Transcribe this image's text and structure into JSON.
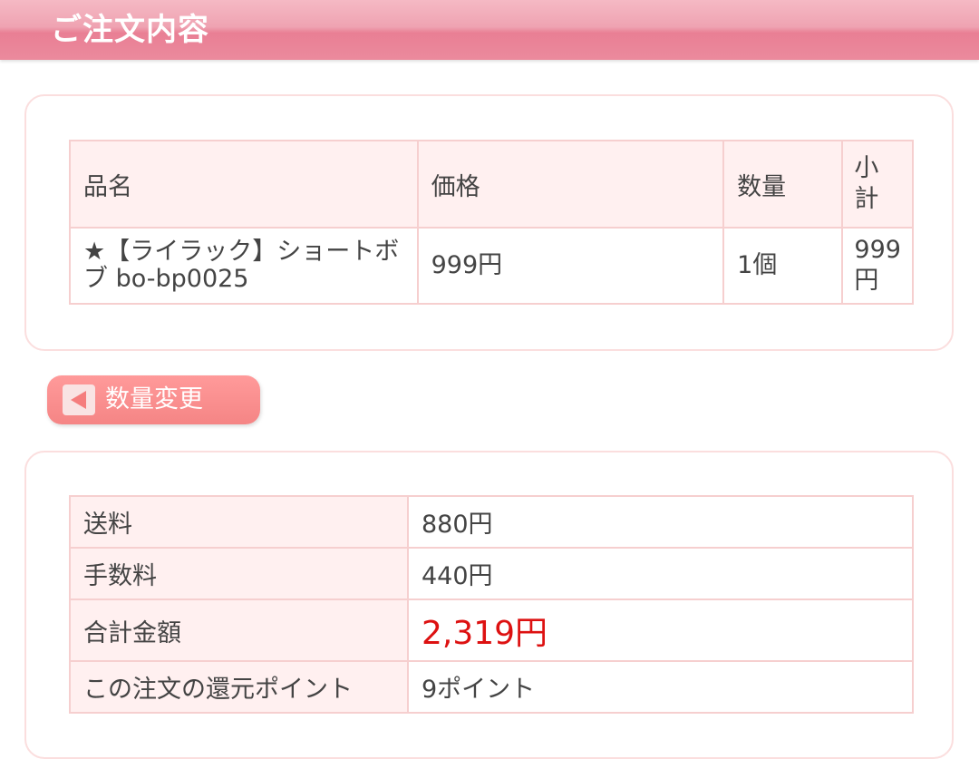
{
  "header": {
    "title": "ご注文内容"
  },
  "order_table": {
    "headers": [
      "品名",
      "価格",
      "数量",
      "小計"
    ],
    "rows": [
      {
        "name": "★【ライラック】ショートボブ bo-bp0025",
        "price": "999円",
        "qty": "1個",
        "subtotal": "999円"
      }
    ]
  },
  "back_button": {
    "label": "数量変更",
    "icon": "left-arrow-icon"
  },
  "summary": {
    "rows": [
      {
        "label": "送料",
        "value": "880円"
      },
      {
        "label": "手数料",
        "value": "440円"
      },
      {
        "label": "合計金額",
        "value": "2,319円"
      },
      {
        "label": "この注文の還元ポイント",
        "value": "9ポイント"
      }
    ]
  },
  "colors": {
    "header": "#e97f94",
    "accent": "#f58585",
    "total": "#dd1111",
    "cell_header_bg": "#fff0f0",
    "border": "#f6cfcf"
  }
}
